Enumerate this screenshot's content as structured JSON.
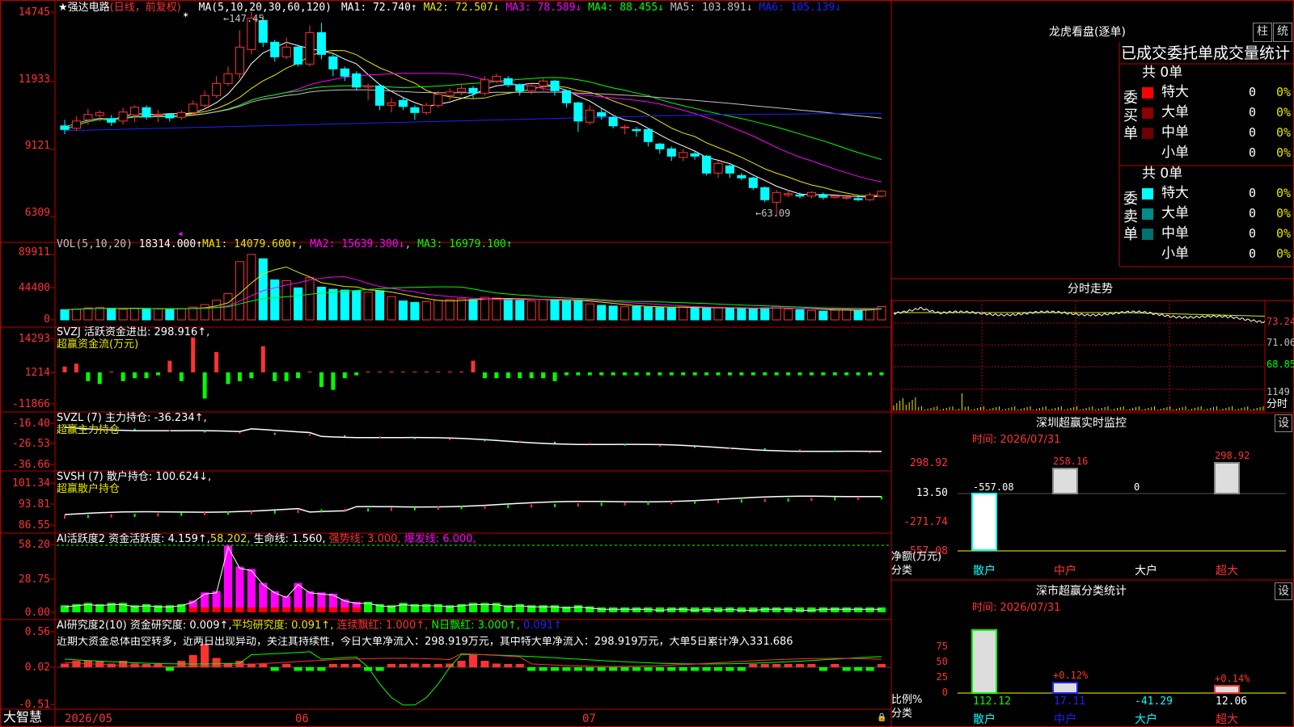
{
  "colors": {
    "up": "#ff3232",
    "down": "#00ffff",
    "grid": "#c00000",
    "ma1": "#ffffff",
    "ma2": "#e6e600",
    "ma3": "#ff00ff",
    "ma4": "#00ff00",
    "ma5": "#c0c0c0",
    "ma6": "#2020ff",
    "green": "#00ff00",
    "yellow": "#ffff00",
    "magenta": "#ff00ff"
  },
  "main": {
    "stock_name": "★强达电路",
    "mode": "(日线，前复权)",
    "ma_def": "MA(5,10,20,30,60,120)",
    "ma1": "MA1: 72.740↑",
    "ma2": "MA2: 72.507↓",
    "ma3": "MA3: 78.589↓",
    "ma4": "MA4: 88.455↓",
    "ma5": "MA5: 103.891↓",
    "ma6": "MA6: 105.139↓",
    "y_ticks": [
      "14745",
      "11933",
      "9121",
      "6309"
    ],
    "high_label": "←147.45",
    "low_label": "←63.09"
  },
  "vol": {
    "label": "VOL(5,10,20)",
    "value": "18314.000↑",
    "ma1": "MA1: 14079.600↑",
    "ma2": "MA2: 15639.300↓",
    "ma3": "MA3: 16979.100↑",
    "y_ticks": [
      "89911",
      "44400",
      "0"
    ]
  },
  "svzj": {
    "label": "SVZJ  活跃资金进出: 298.916↑,",
    "sub": "超赢资金流(万元)",
    "y_ticks": [
      "14293",
      "1214",
      "-11866"
    ]
  },
  "svzl": {
    "label": "SVZL (7) 主力持仓: -36.234↑,",
    "sub": "超赢主力持仓",
    "y_ticks": [
      "-16.40",
      "-26.53",
      "-36.66"
    ]
  },
  "svsh": {
    "label": "SVSH (7) 散户持仓: 100.624↓,",
    "sub": "超赢散户持仓",
    "y_ticks": [
      "101.34",
      "93.81",
      "86.55"
    ]
  },
  "ai1": {
    "label": "AI活跃度2 资金活跃度: 4.159↑,",
    "v2": "58.202,",
    "life": "生命线: 1.560,",
    "strong": "强势线: 3.000,",
    "burst": "爆发线: 6.000,",
    "y_ticks": [
      "58.20",
      "28.75",
      "0.00"
    ]
  },
  "ai2": {
    "label": "AI研究度2(10) 资金研究度: 0.009↑,",
    "avg": "平均研究度: 0.091↑,",
    "lian": "连续飘红: 1.000↑,",
    "nday": "N日飘红: 3.000↑,",
    "last": "0.091↑",
    "desc": "近期大资金总体由空转多，近两日出现异动，关注其持续性，今日大单净流入：298.919万元，其中特大单净流入：298.919万元，大单5日累计净入331.686",
    "y_ticks": [
      "0.56",
      "0.02",
      "-0.51"
    ]
  },
  "xaxis": {
    "brand": "大智慧",
    "labels": [
      "2026/05",
      "06",
      "07"
    ]
  },
  "right": {
    "lhkp": "龙虎看盘(逐单)",
    "btn_zhu": "柱",
    "btn_stat": "统",
    "title": "已成交委托单成交量统计",
    "buy": {
      "side": [
        "委",
        "买",
        "单"
      ],
      "total": "共 0单",
      "rows": [
        {
          "label": "特大",
          "count": "0",
          "pct": "0%"
        },
        {
          "label": "大单",
          "count": "0",
          "pct": "0%"
        },
        {
          "label": "中单",
          "count": "0",
          "pct": "0%"
        },
        {
          "label": "小单",
          "count": "0",
          "pct": "0%"
        }
      ]
    },
    "sell": {
      "side": [
        "委",
        "卖",
        "单"
      ],
      "total": "共 0单",
      "rows": [
        {
          "label": "特大",
          "count": "0",
          "pct": "0%"
        },
        {
          "label": "大单",
          "count": "0",
          "pct": "0%"
        },
        {
          "label": "中单",
          "count": "0",
          "pct": "0%"
        },
        {
          "label": "小单",
          "count": "0",
          "pct": "0%"
        }
      ]
    },
    "intraday": {
      "title": "分时走势",
      "y_ticks": [
        "73.24",
        "71.06",
        "68.85"
      ],
      "vol_tick": "1149",
      "unit": "分时"
    },
    "monitor": {
      "title": "深圳超赢实时监控",
      "btn": "设",
      "date": "时间: 2026/07/31",
      "y_ticks": [
        "298.92",
        "13.50",
        "-271.74",
        "-557.08"
      ],
      "axis_title1": "净额(万元)",
      "axis_title2": "分类",
      "bars": [
        {
          "cat": "散户",
          "value": "-557.08"
        },
        {
          "cat": "中户",
          "value": "258.16"
        },
        {
          "cat": "大户",
          "value": "0"
        },
        {
          "cat": "超大",
          "value": "298.92"
        }
      ]
    },
    "classify": {
      "title": "深市超赢分类统计",
      "btn": "设",
      "date": "时间: 2026/07/31",
      "y_ticks": [
        "75",
        "50",
        "25",
        "0"
      ],
      "axis_title1": "比例%",
      "axis_title2": "分类",
      "pcts": [
        "+0.12%",
        "+0.14%"
      ],
      "bars": [
        {
          "cat": "散户",
          "value": "112.12"
        },
        {
          "cat": "中户",
          "value": "17.11"
        },
        {
          "cat": "大户",
          "value": "-41.29"
        },
        {
          "cat": "超大",
          "value": "12.06"
        }
      ]
    }
  },
  "chart_data": {
    "type": "candlestick",
    "title": "强达电路 日线",
    "x_labels": [
      "2026/05",
      "06",
      "07"
    ],
    "price_range": [
      6309,
      14745
    ],
    "candles": [
      [
        10050,
        9900,
        10300,
        9700
      ],
      [
        9950,
        10250,
        10450,
        9850
      ],
      [
        10300,
        10520,
        10760,
        10100
      ],
      [
        10480,
        10600,
        10700,
        10220
      ],
      [
        10350,
        10200,
        10500,
        10050
      ],
      [
        10250,
        10620,
        10800,
        10100
      ],
      [
        10500,
        10820,
        10900,
        10200
      ],
      [
        10800,
        10420,
        10900,
        10300
      ],
      [
        10500,
        10530,
        10700,
        10200
      ],
      [
        10520,
        10380,
        10580,
        10230
      ],
      [
        10400,
        10600,
        10700,
        10300
      ],
      [
        10600,
        10950,
        11100,
        10500
      ],
      [
        10900,
        11300,
        11500,
        10800
      ],
      [
        11300,
        11800,
        12100,
        11200
      ],
      [
        11800,
        12200,
        12500,
        11700
      ],
      [
        12200,
        13300,
        14000,
        12000
      ],
      [
        13200,
        14500,
        14745,
        13000
      ],
      [
        14400,
        13500,
        14600,
        13300
      ],
      [
        13500,
        12900,
        13600,
        12700
      ],
      [
        12900,
        13300,
        13700,
        12800
      ],
      [
        13300,
        12600,
        13400,
        12500
      ],
      [
        12600,
        13900,
        14200,
        12500
      ],
      [
        13900,
        13000,
        14300,
        12800
      ],
      [
        12900,
        12400,
        13000,
        12100
      ],
      [
        12400,
        12100,
        12500,
        11900
      ],
      [
        12200,
        11650,
        12300,
        11500
      ],
      [
        11650,
        11700,
        11800,
        11100
      ],
      [
        11700,
        10900,
        11750,
        10700
      ],
      [
        10900,
        11000,
        11200,
        10600
      ],
      [
        11100,
        10850,
        11200,
        10700
      ],
      [
        10800,
        10600,
        10900,
        10300
      ],
      [
        10600,
        10900,
        11000,
        10500
      ],
      [
        10900,
        11350,
        11500,
        10800
      ],
      [
        11300,
        11450,
        11600,
        11100
      ],
      [
        11450,
        11600,
        11800,
        11300
      ],
      [
        11600,
        11400,
        11700,
        11200
      ],
      [
        11400,
        11950,
        12100,
        11300
      ],
      [
        11900,
        12100,
        12200,
        11800
      ],
      [
        12000,
        11750,
        12100,
        11650
      ],
      [
        11750,
        11500,
        11800,
        11300
      ],
      [
        11500,
        11700,
        11800,
        11350
      ],
      [
        11700,
        11900,
        12000,
        11500
      ],
      [
        11900,
        11500,
        11950,
        11300
      ],
      [
        11500,
        11000,
        11550,
        10800
      ],
      [
        11000,
        10250,
        11050,
        9800
      ],
      [
        10200,
        10700,
        10900,
        10100
      ],
      [
        10600,
        10450,
        10800,
        10300
      ],
      [
        10400,
        10050,
        10450,
        9950
      ],
      [
        10000,
        10000,
        10100,
        9700
      ],
      [
        9900,
        9850,
        10000,
        9600
      ],
      [
        9900,
        9400,
        9900,
        9200
      ],
      [
        9300,
        9100,
        9350,
        8900
      ],
      [
        9100,
        8800,
        9200,
        8600
      ],
      [
        8750,
        8950,
        9100,
        8600
      ],
      [
        8900,
        8800,
        9000,
        8650
      ],
      [
        8800,
        8100,
        8850,
        8000
      ],
      [
        8100,
        8500,
        8600,
        7900
      ],
      [
        8400,
        8100,
        8450,
        7900
      ],
      [
        8000,
        7900,
        8100,
        7800
      ],
      [
        7900,
        7500,
        7950,
        7400
      ],
      [
        7500,
        7000,
        7550,
        6900
      ],
      [
        6900,
        7300,
        7400,
        6309
      ],
      [
        7200,
        7250,
        7400,
        7100
      ],
      [
        7200,
        7150,
        7300,
        7050
      ],
      [
        7150,
        7300,
        7350,
        7050
      ],
      [
        7200,
        7100,
        7300,
        7000
      ],
      [
        7100,
        7150,
        7250,
        7050
      ],
      [
        7100,
        7100,
        7200,
        7000
      ],
      [
        7050,
        7000,
        7200,
        6950
      ],
      [
        7000,
        7200,
        7300,
        6950
      ],
      [
        7150,
        7350,
        7400,
        7100
      ]
    ],
    "ma_series": [
      {
        "name": "MA1",
        "value": 72.74
      },
      {
        "name": "MA2",
        "value": 72.507
      },
      {
        "name": "MA3",
        "value": 78.589
      },
      {
        "name": "MA4",
        "value": 88.455
      },
      {
        "name": "MA5",
        "value": 103.891
      },
      {
        "name": "MA6",
        "value": 105.139
      }
    ],
    "volume": [
      14000,
      15000,
      16500,
      17000,
      16000,
      14500,
      16000,
      15500,
      15000,
      14500,
      15500,
      17500,
      21000,
      27000,
      36000,
      80000,
      89911,
      84000,
      55000,
      54000,
      44000,
      58000,
      45000,
      42000,
      41000,
      40000,
      38000,
      40000,
      32000,
      26000,
      24000,
      25000,
      27000,
      28000,
      29000,
      28000,
      31000,
      30000,
      29000,
      27000,
      26000,
      28000,
      27000,
      26500,
      26000,
      22000,
      20000,
      19000,
      18000,
      18500,
      17500,
      17000,
      16500,
      17500,
      17000,
      16000,
      16500,
      16000,
      15500,
      15000,
      16500,
      18500,
      15000,
      14000,
      13000,
      12000,
      13500,
      14500,
      12500,
      15500,
      18314
    ]
  }
}
